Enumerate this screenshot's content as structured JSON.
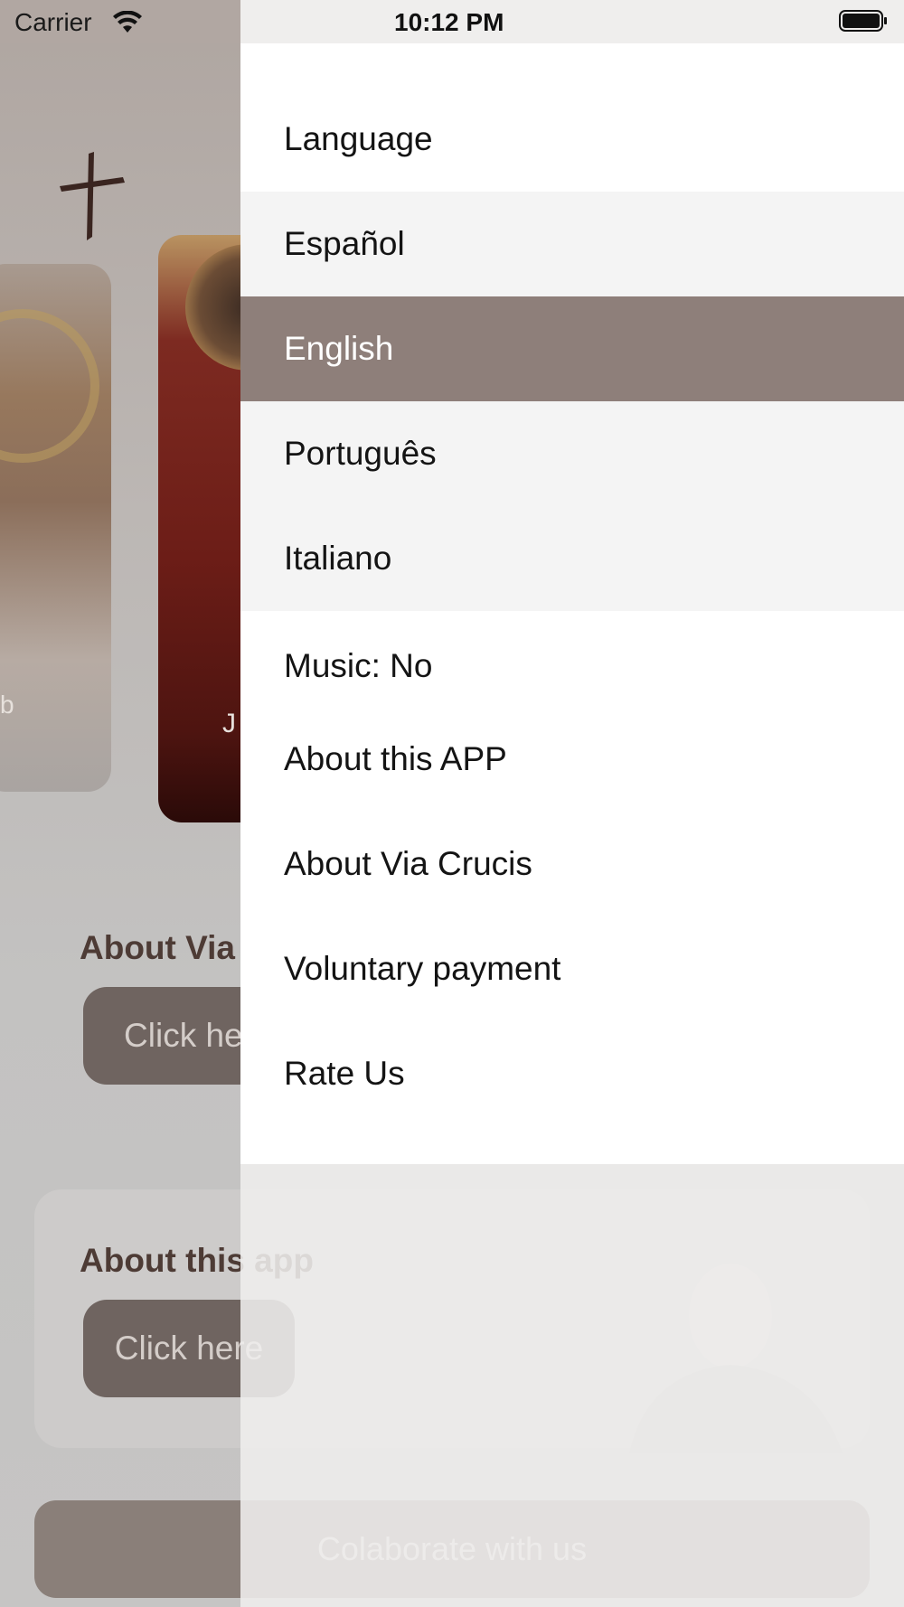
{
  "status_bar": {
    "carrier": "Carrier",
    "time": "10:12 PM"
  },
  "background": {
    "card_left_label": "b",
    "card_main_label": "J",
    "about_via": {
      "title": "About Via",
      "button": "Click her"
    },
    "about_app": {
      "title": "About this app",
      "button": "Click here"
    },
    "collaborate": "Colaborate with us"
  },
  "menu": {
    "items": [
      {
        "label": "Language",
        "type": "header"
      },
      {
        "label": "Español",
        "type": "language"
      },
      {
        "label": "English",
        "type": "language",
        "selected": true
      },
      {
        "label": "Português",
        "type": "language"
      },
      {
        "label": "Italiano",
        "type": "language"
      },
      {
        "label": "Music: No",
        "type": "option"
      },
      {
        "label": "About this APP",
        "type": "option"
      },
      {
        "label": "About Via Crucis",
        "type": "option"
      },
      {
        "label": "Voluntary payment",
        "type": "option"
      },
      {
        "label": "Rate Us",
        "type": "option"
      }
    ]
  },
  "colors": {
    "selected": "#8e7f7a",
    "brand_dark": "#4d3b35",
    "button": "#6f6460"
  },
  "icons": [
    "wifi-icon",
    "battery-icon",
    "cross-icon"
  ]
}
